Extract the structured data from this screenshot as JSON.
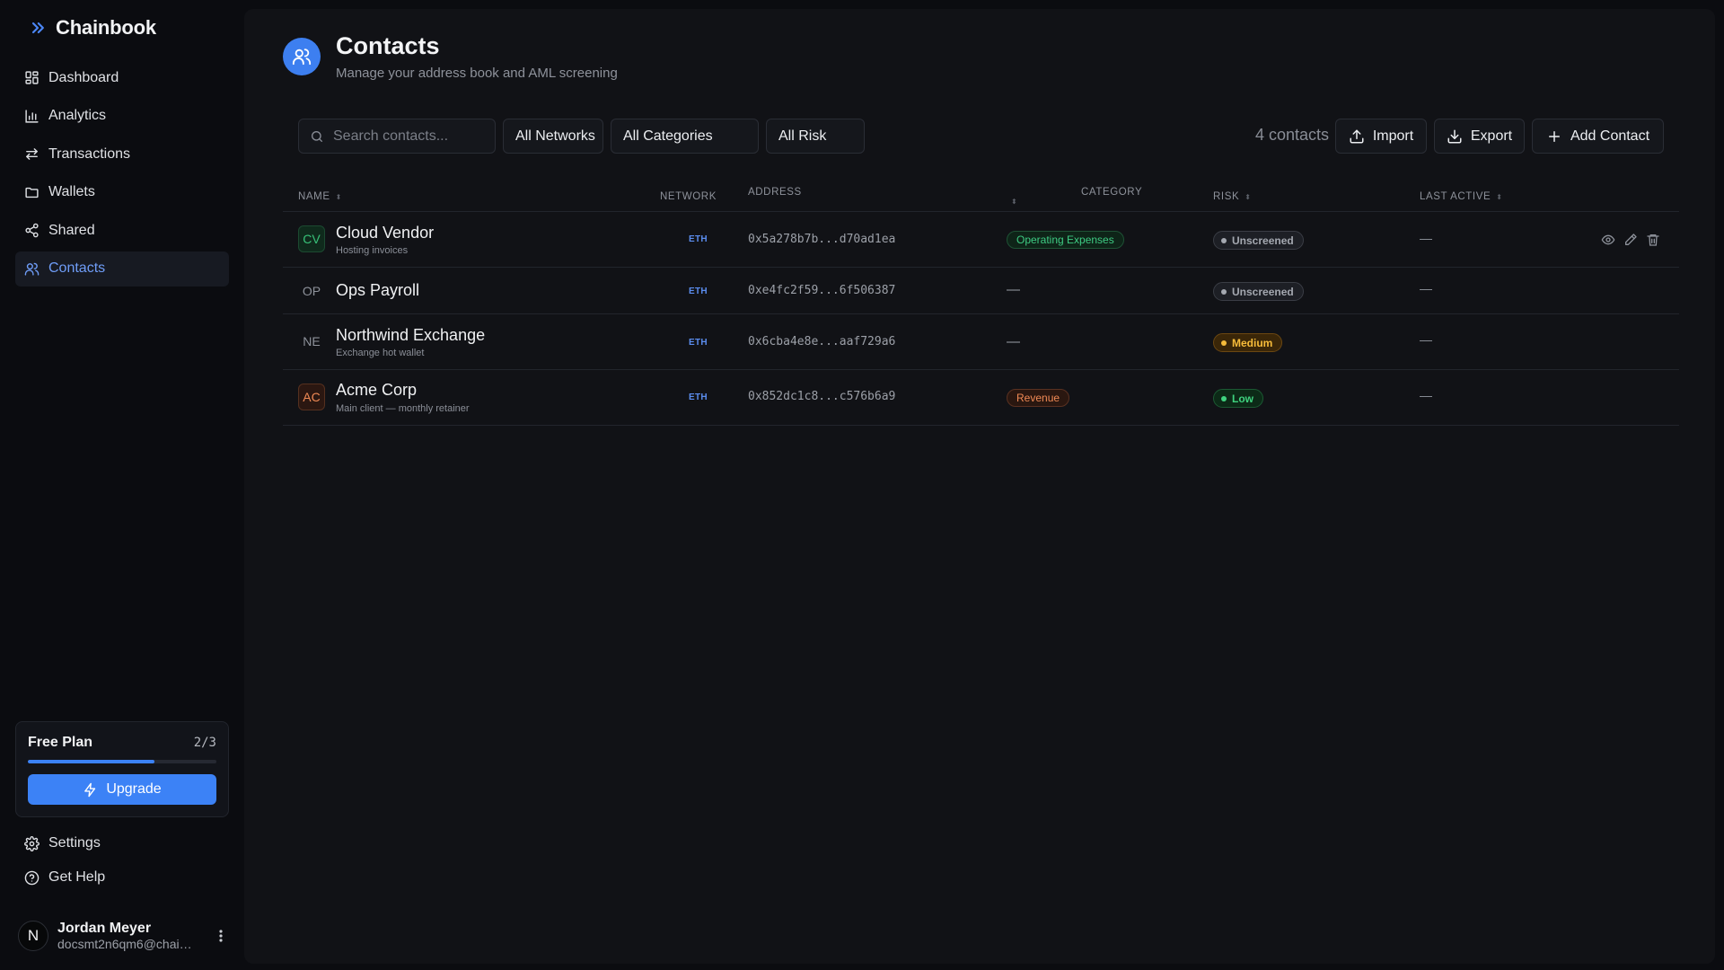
{
  "app": {
    "name": "Chainbook"
  },
  "sidebar": {
    "items": [
      {
        "label": "Dashboard",
        "icon": "dashboard-icon"
      },
      {
        "label": "Analytics",
        "icon": "bar-chart-icon"
      },
      {
        "label": "Transactions",
        "icon": "arrows-swap-icon"
      },
      {
        "label": "Wallets",
        "icon": "folder-icon"
      },
      {
        "label": "Shared",
        "icon": "share-icon"
      },
      {
        "label": "Contacts",
        "icon": "users-icon",
        "active": true
      }
    ],
    "plan": {
      "name": "Free Plan",
      "count": "2/3",
      "progress": 0.67,
      "upgrade_label": "Upgrade"
    },
    "bottom": [
      {
        "label": "Settings",
        "icon": "gear-icon"
      },
      {
        "label": "Get Help",
        "icon": "help-circle-icon"
      }
    ],
    "user": {
      "initial": "N",
      "name": "Jordan Meyer",
      "email": "docsmt2n6qm6@chain..."
    }
  },
  "header": {
    "title": "Contacts",
    "subtitle": "Manage your address book and AML screening"
  },
  "toolbar": {
    "search_placeholder": "Search contacts...",
    "network_filter": "All Networks",
    "category_filter": "All Categories",
    "risk_filter": "All Risk",
    "count_text": "4 contacts",
    "import_label": "Import",
    "export_label": "Export",
    "add_label": "Add Contact"
  },
  "table": {
    "headers": {
      "name": "NAME",
      "network": "NETWORK",
      "address": "ADDRESS",
      "category": "CATEGORY",
      "risk": "RISK",
      "last_active": "LAST ACTIVE"
    },
    "rows": [
      {
        "initials": "CV",
        "name": "Cloud Vendor",
        "note": "Hosting invoices",
        "network": "ETH",
        "address": "0x5a278b7b...d70ad1ea",
        "category": "Operating Expenses",
        "risk": "Unscreened",
        "last_active": "—"
      },
      {
        "initials": "OP",
        "name": "Ops Payroll",
        "note": "",
        "network": "ETH",
        "address": "0xe4fc2f59...6f506387",
        "category": "—",
        "risk": "Unscreened",
        "last_active": "—"
      },
      {
        "initials": "NE",
        "name": "Northwind Exchange",
        "note": "Exchange hot wallet",
        "network": "ETH",
        "address": "0x6cba4e8e...aaf729a6",
        "category": "—",
        "risk": "Medium",
        "last_active": "—"
      },
      {
        "initials": "AC",
        "name": "Acme Corp",
        "note": "Main client — monthly retainer",
        "network": "ETH",
        "address": "0x852dc1c8...c576b6a9",
        "category": "Revenue",
        "risk": "Low",
        "last_active": "—"
      }
    ]
  },
  "colors": {
    "accent": "#3c82f6",
    "active_nav": "#6f9df7",
    "background": "#0b0c10",
    "panel": "#111216"
  }
}
